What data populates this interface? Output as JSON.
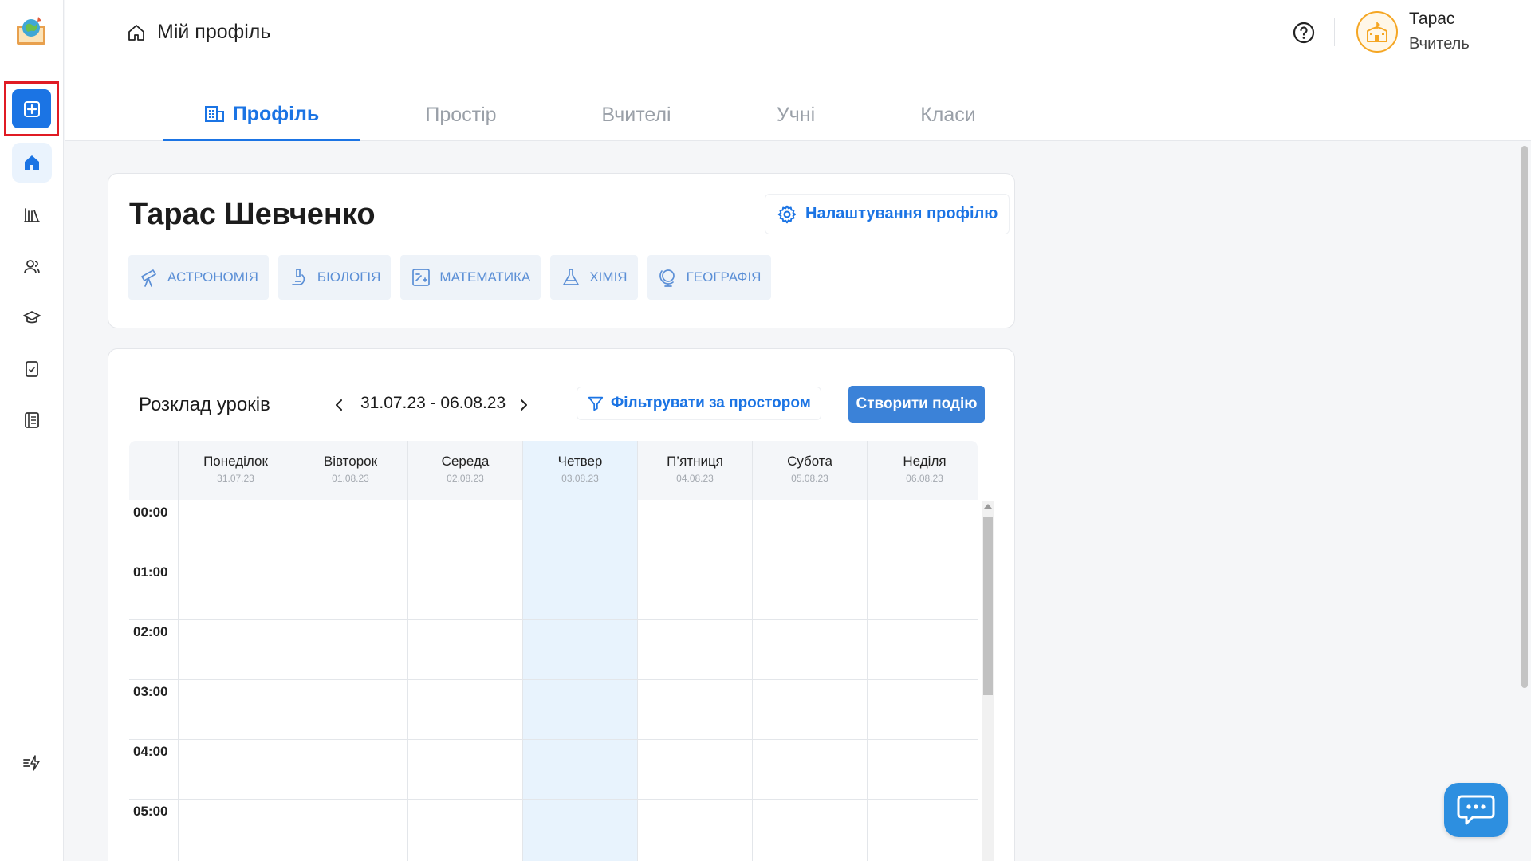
{
  "header": {
    "title": "Мій профіль",
    "user": {
      "name": "Тарас",
      "role": "Вчитель"
    }
  },
  "tabs": [
    {
      "label": "Профіль",
      "active": true
    },
    {
      "label": "Простір",
      "active": false
    },
    {
      "label": "Вчителі",
      "active": false
    },
    {
      "label": "Учні",
      "active": false
    },
    {
      "label": "Класи",
      "active": false
    }
  ],
  "profile": {
    "full_name": "Тарас Шевченко",
    "settings_label": "Налаштування профілю",
    "subjects": [
      {
        "label": "Астрономія",
        "icon": "telescope-icon"
      },
      {
        "label": "Біологія",
        "icon": "microscope-icon"
      },
      {
        "label": "Математика",
        "icon": "calculator-icon"
      },
      {
        "label": "Хімія",
        "icon": "flask-icon"
      },
      {
        "label": "Географія",
        "icon": "globe-icon"
      }
    ]
  },
  "schedule": {
    "title": "Розклад уроків",
    "range": "31.07.23 - 06.08.23",
    "filter_label": "Фільтрувати за простором",
    "create_label": "Створити подію",
    "days": [
      {
        "name": "Понеділок",
        "date": "31.07.23"
      },
      {
        "name": "Вівторок",
        "date": "01.08.23"
      },
      {
        "name": "Середа",
        "date": "02.08.23"
      },
      {
        "name": "Четвер",
        "date": "03.08.23",
        "today": true
      },
      {
        "name": "П’ятниця",
        "date": "04.08.23"
      },
      {
        "name": "Субота",
        "date": "05.08.23"
      },
      {
        "name": "Неділя",
        "date": "06.08.23"
      }
    ],
    "times": [
      "00:00",
      "01:00",
      "02:00",
      "03:00",
      "04:00",
      "05:00"
    ]
  },
  "colors": {
    "accent": "#1b74e4",
    "today": "#e8f3fd",
    "highlight": "#e01b24",
    "avatar": "#f5a623"
  },
  "icons": {
    "sidebar": [
      "add-icon",
      "home-icon",
      "library-icon",
      "users-icon",
      "graduation-cap-icon",
      "assignment-icon",
      "journal-icon",
      "quick-actions-icon"
    ]
  }
}
